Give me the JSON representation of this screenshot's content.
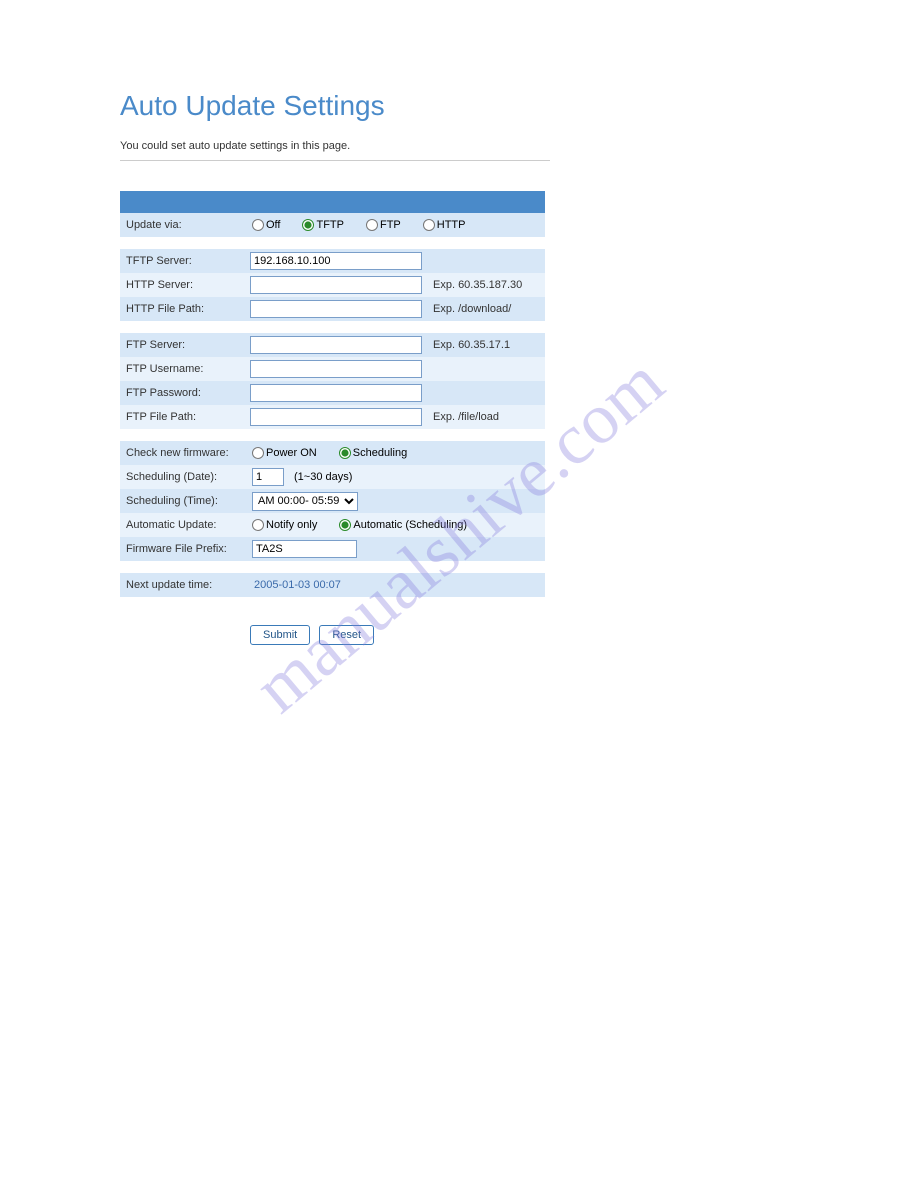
{
  "watermark": "manualshive.com",
  "title": "Auto Update Settings",
  "subtitle": "You could set auto update settings in this page.",
  "update_via": {
    "label": "Update via:",
    "options": {
      "off": "Off",
      "tftp": "TFTP",
      "ftp": "FTP",
      "http": "HTTP"
    },
    "selected": "tftp"
  },
  "servers": {
    "tftp": {
      "label": "TFTP Server:",
      "value": "192.168.10.100"
    },
    "http_server": {
      "label": "HTTP Server:",
      "value": "",
      "hint": "Exp. 60.35.187.30"
    },
    "http_path": {
      "label": "HTTP File Path:",
      "value": "",
      "hint": "Exp. /download/"
    },
    "ftp_server": {
      "label": "FTP Server:",
      "value": "",
      "hint": "Exp. 60.35.17.1"
    },
    "ftp_user": {
      "label": "FTP Username:",
      "value": ""
    },
    "ftp_pass": {
      "label": "FTP Password:",
      "value": ""
    },
    "ftp_path": {
      "label": "FTP File Path:",
      "value": "",
      "hint": "Exp. /file/load"
    }
  },
  "schedule": {
    "check": {
      "label": "Check new firmware:",
      "options": {
        "power": "Power ON",
        "sched": "Scheduling"
      },
      "selected": "sched"
    },
    "date": {
      "label": "Scheduling (Date):",
      "value": "1",
      "hint": "(1~30 days)"
    },
    "time": {
      "label": "Scheduling (Time):",
      "value": "AM 00:00- 05:59"
    },
    "auto": {
      "label": "Automatic Update:",
      "options": {
        "notify": "Notify only",
        "auto": "Automatic (Scheduling)"
      },
      "selected": "auto"
    },
    "prefix": {
      "label": "Firmware File Prefix:",
      "value": "TA2S"
    }
  },
  "next": {
    "label": "Next update time:",
    "value": "2005-01-03 00:07"
  },
  "buttons": {
    "submit": "Submit",
    "reset": "Reset"
  }
}
